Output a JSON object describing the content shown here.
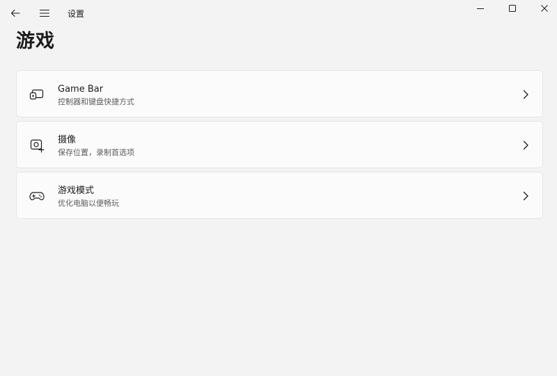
{
  "app": {
    "title": "设置"
  },
  "page": {
    "title": "游戏"
  },
  "icons": {
    "back": "back-arrow-icon",
    "menu": "hamburger-menu-icon",
    "minimize": "minimize-icon",
    "maximize": "maximize-icon",
    "close": "close-icon",
    "chevron": "chevron-right-icon"
  },
  "cards": [
    {
      "title": "Game Bar",
      "subtitle": "控制器和键盘快捷方式",
      "icon": "game-bar-icon"
    },
    {
      "title": "摄像",
      "subtitle": "保存位置，录制首选项",
      "icon": "capture-icon"
    },
    {
      "title": "游戏模式",
      "subtitle": "优化电脑以便畅玩",
      "icon": "game-controller-icon"
    }
  ],
  "colors": {
    "background": "#f3f3f3",
    "card": "#fbfbfb",
    "border": "#e5e5e5",
    "text": "#1b1b1b",
    "subtext": "#5d5d5d"
  }
}
